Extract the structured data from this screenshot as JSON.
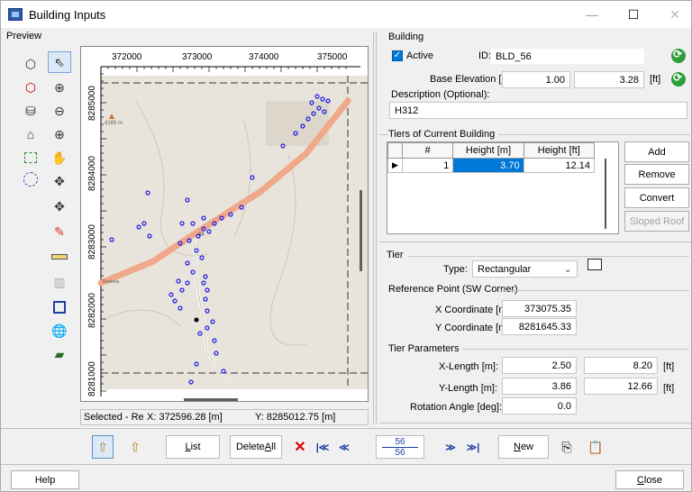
{
  "window": {
    "title": "Building Inputs",
    "minimize": "—",
    "maximize": "☐",
    "close": "✕"
  },
  "preview": {
    "label": "Preview",
    "x_ticks": [
      "372000",
      "373000",
      "374000",
      "375000"
    ],
    "y_ticks": [
      "8285000",
      "8284000",
      "8283000",
      "8282000",
      "8281000"
    ],
    "elev_label": "4165 m",
    "marker_label": "34",
    "road_label_1": "Rodovia ... Paulo",
    "road_label_2": "Rodovia",
    "status_selected": "Selected - Re",
    "status_x": "X: 372596.28 [m]",
    "status_y": "Y: 8285012.75 [m]"
  },
  "building": {
    "section": "Building",
    "active_label": "Active",
    "active": true,
    "id_label": "ID:",
    "id_value": "BLD_56",
    "base_elev_label": "Base Elevation [m]:",
    "base_elev_m": "1.00",
    "base_elev_ft": "3.28",
    "ft_unit": "[ft]",
    "desc_label": "Description (Optional):",
    "desc_value": "H312"
  },
  "tiers": {
    "section": "Tiers of Current Building",
    "columns": [
      "#",
      "Height [m]",
      "Height [ft]"
    ],
    "rows": [
      {
        "num": "1",
        "height_m": "3.70",
        "height_ft": "12.14"
      }
    ],
    "add": "Add",
    "remove": "Remove",
    "convert": "Convert",
    "sloped_roof": "Sloped Roof"
  },
  "tier": {
    "section": "Tier",
    "type_label": "Type:",
    "type_value": "Rectangular",
    "ref_section": "Reference Point (SW Corner)",
    "x_label": "X Coordinate [m]:",
    "x_value": "373075.35",
    "y_label": "Y Coordinate [m]:",
    "y_value": "8281645.33",
    "params_section": "Tier Parameters",
    "xlen_label": "X-Length [m]:",
    "xlen_m": "2.50",
    "xlen_ft": "8.20",
    "ylen_label": "Y-Length [m]:",
    "ylen_m": "3.86",
    "ylen_ft": "12.66",
    "rot_label": "Rotation Angle [deg]:",
    "rot_value": "0.0",
    "ft_unit": "[ft]"
  },
  "bottom": {
    "list": "List",
    "delete_all": "Delete All",
    "delete_x": "✕",
    "first": "|≪",
    "prev": "≪",
    "page_current": "56",
    "page_total": "56",
    "next": "≫",
    "last": "≫|",
    "new": "New",
    "help": "Help",
    "close": "Close"
  },
  "colors": {
    "accent": "#0078d7",
    "road": "#f0a88a",
    "point": "#1a1ae6",
    "green": "#2e9e3a"
  }
}
